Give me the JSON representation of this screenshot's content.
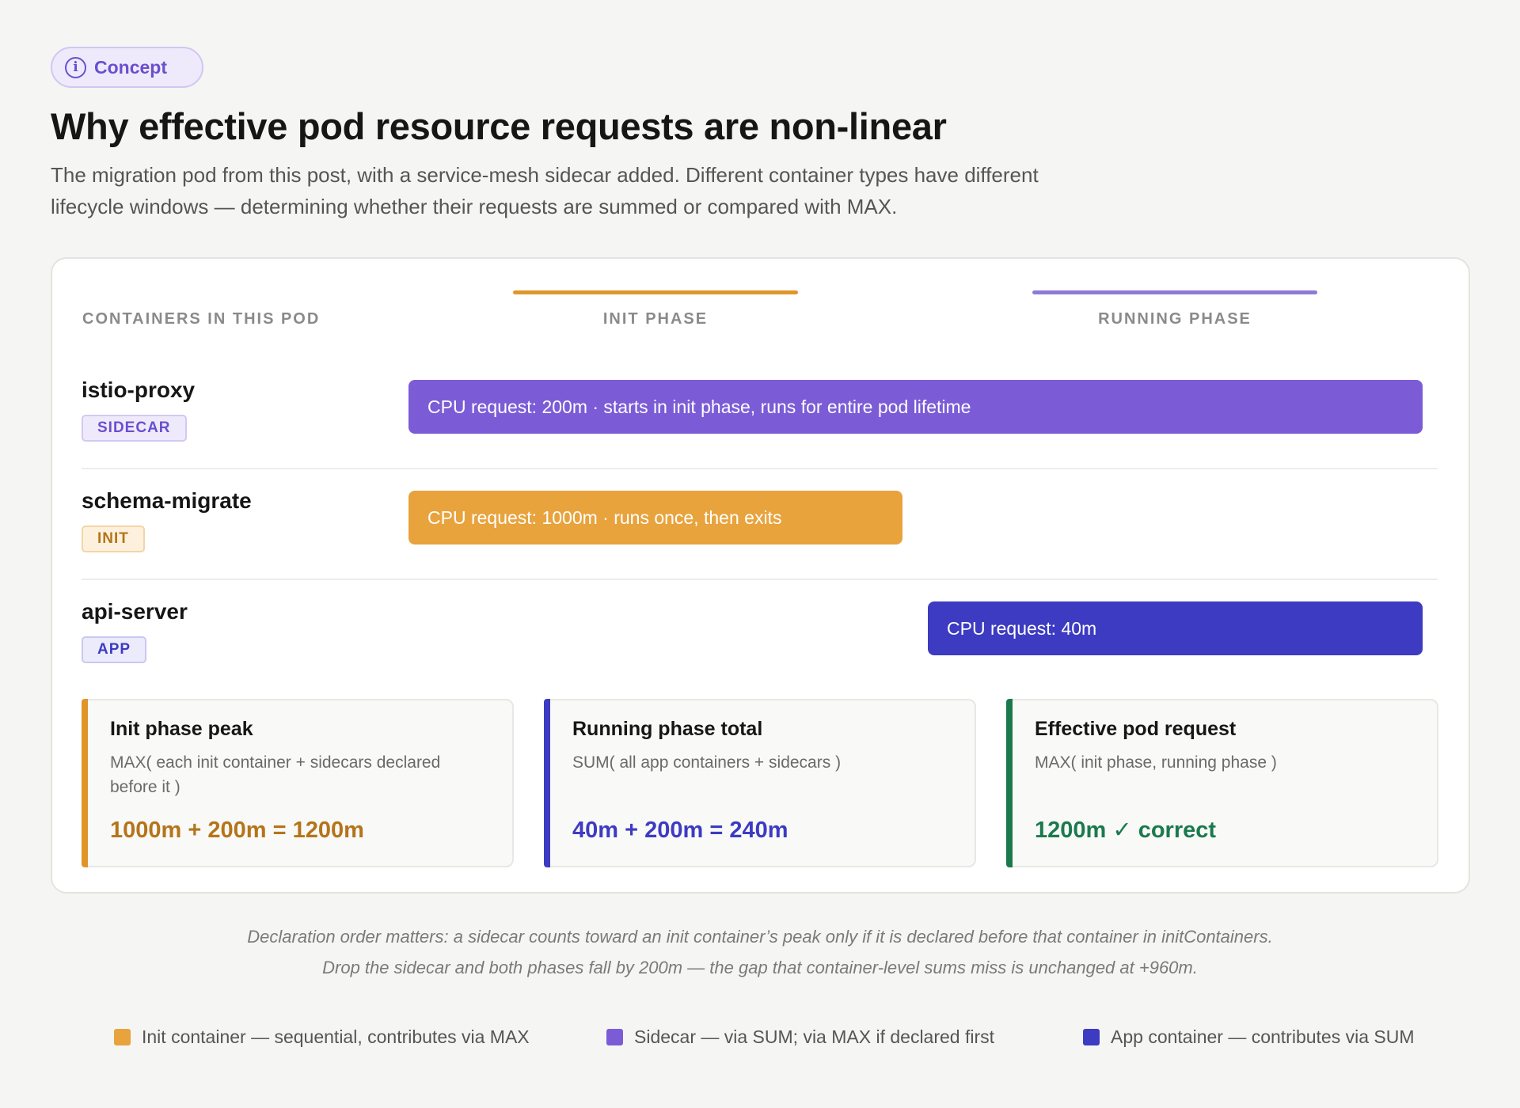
{
  "header": {
    "badge_label": "Concept",
    "title": "Why effective pod resource requests are non-linear",
    "subtitle": "The migration pod from this post, with a service-mesh sidecar added. Different container types have different lifecycle windows — determining whether their requests are summed or compared with MAX."
  },
  "columns": {
    "containers": "CONTAINERS IN THIS POD",
    "init": "INIT PHASE",
    "running": "RUNNING PHASE"
  },
  "colors": {
    "init": "#e8a33d",
    "sidecar": "#7b5cd6",
    "app": "#3d3bc2",
    "correct": "#1a7a4c"
  },
  "rows": [
    {
      "name": "istio-proxy",
      "tag": "SIDECAR",
      "bar": "CPU request: 200m · starts in init phase, runs for entire pod lifetime"
    },
    {
      "name": "schema-migrate",
      "tag": "INIT",
      "bar": "CPU request: 1000m · runs once, then exits"
    },
    {
      "name": "api-server",
      "tag": "APP",
      "bar": "CPU request: 40m"
    }
  ],
  "calcs": [
    {
      "title": "Init phase peak",
      "formula": "MAX( each init container + sidecars declared before it )",
      "result": "1000m + 200m = 1200m"
    },
    {
      "title": "Running phase total",
      "formula": "SUM( all app containers + sidecars )",
      "result": "40m + 200m = 240m"
    },
    {
      "title": "Effective pod request",
      "formula": "MAX( init phase, running phase )",
      "result": "1200m ✓ correct"
    }
  ],
  "notes": [
    "Declaration order matters: a sidecar counts toward an init container’s peak only if it is declared before that container in initContainers.",
    "Drop the sidecar and both phases fall by 200m — the gap that container-level sums miss is unchanged at +960m."
  ],
  "legend": [
    {
      "label": "Init container — sequential, contributes via MAX"
    },
    {
      "label": "Sidecar — via SUM; via MAX if declared first"
    },
    {
      "label": "App container — contributes via SUM"
    }
  ]
}
